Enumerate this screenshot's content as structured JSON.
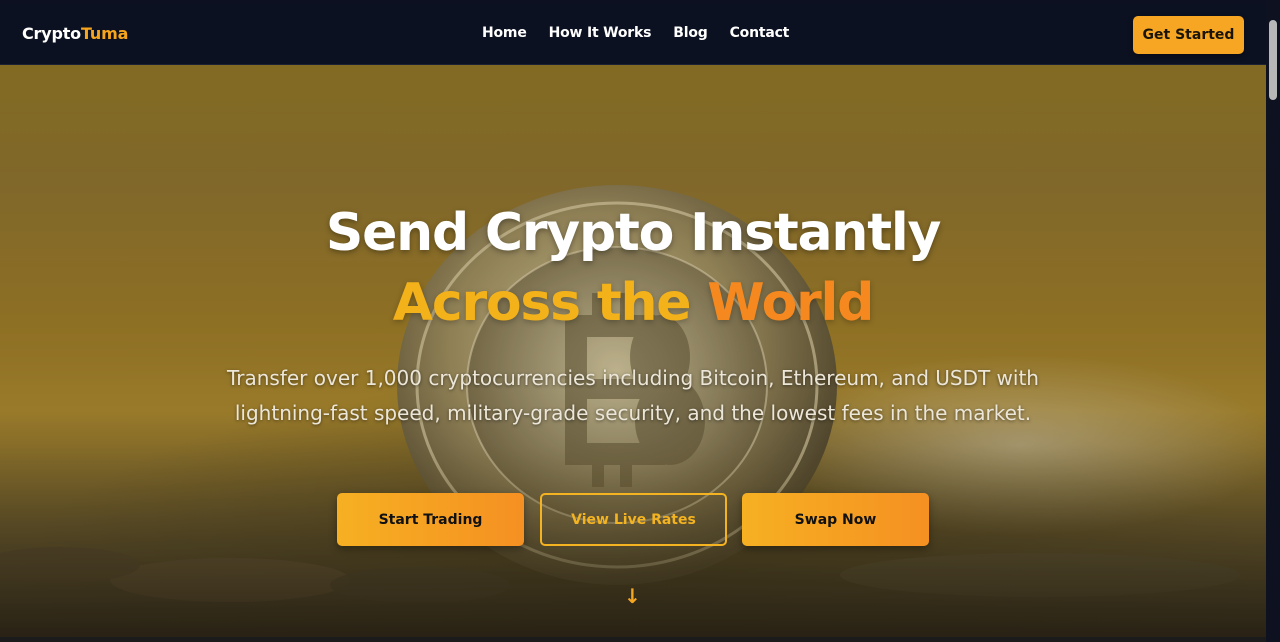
{
  "brand": {
    "part1": "Crypto",
    "part2": "Tuma"
  },
  "nav": {
    "links": [
      "Home",
      "How It Works",
      "Blog",
      "Contact"
    ],
    "cta": "Get Started"
  },
  "hero": {
    "title_line1": "Send Crypto Instantly",
    "title_line2_a": "Across the",
    "title_line2_b": "World",
    "subtitle": "Transfer over 1,000 cryptocurrencies including Bitcoin, Ethereum, and USDT with lightning-fast speed, military-grade security, and the lowest fees in the market.",
    "buttons": {
      "start_trading": "Start Trading",
      "view_live_rates": "View Live Rates",
      "swap_now": "Swap Now"
    },
    "scroll_icon": "↓"
  },
  "colors": {
    "accent": "#f6a623",
    "accent_orange": "#f5891f",
    "nav_bg": "#0c1121"
  }
}
